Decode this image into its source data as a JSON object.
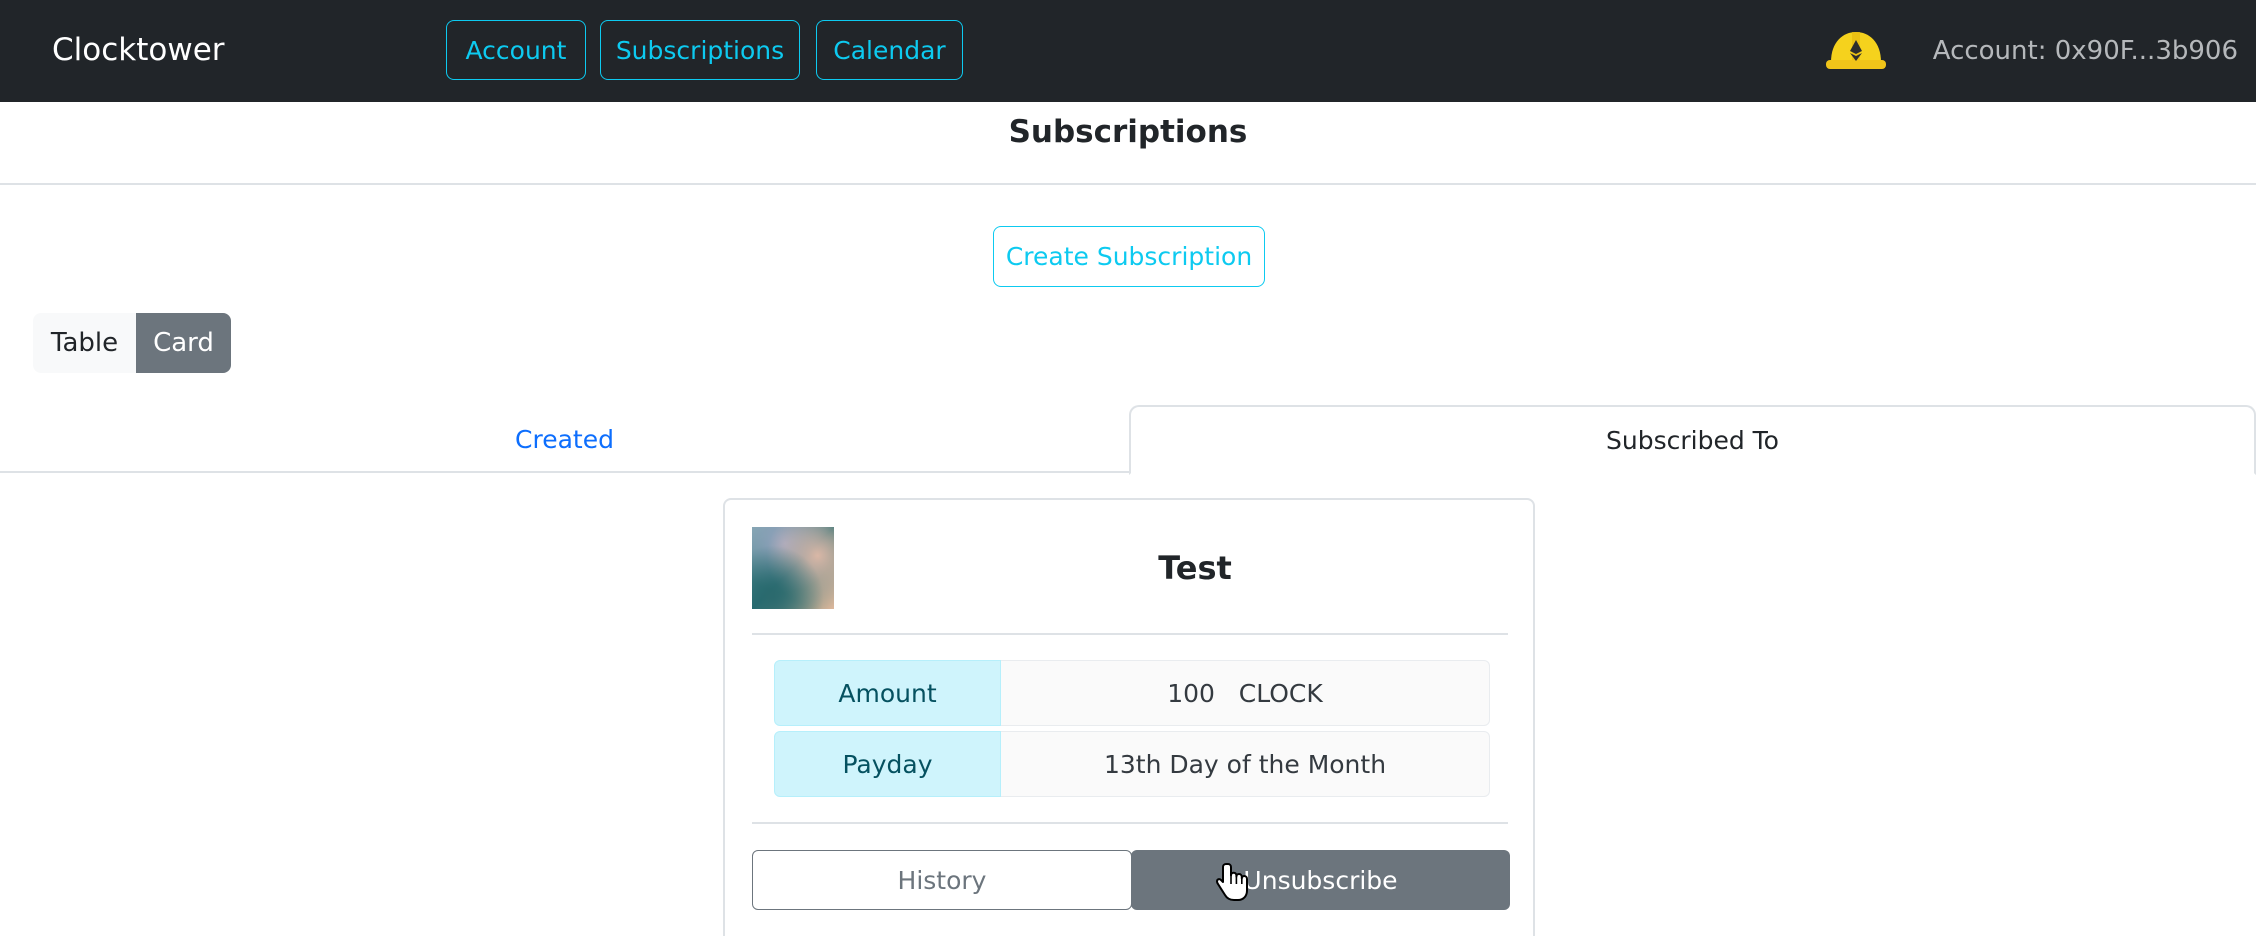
{
  "navbar": {
    "brand": "Clocktower",
    "links": [
      {
        "label": "Account"
      },
      {
        "label": "Subscriptions"
      },
      {
        "label": "Calendar"
      }
    ],
    "wallet_icon": "metamask-helmet-icon",
    "account_text": "Account: 0x90F...3b906"
  },
  "page": {
    "title": "Subscriptions",
    "create_button": "Create Subscription"
  },
  "view_toggle": {
    "options": [
      "Table",
      "Card"
    ],
    "selected": "Card"
  },
  "tabs": [
    {
      "label": "Created",
      "active": false
    },
    {
      "label": "Subscribed To",
      "active": true
    }
  ],
  "card": {
    "title": "Test",
    "rows": [
      {
        "label": "Amount",
        "value": "100   CLOCK"
      },
      {
        "label": "Payday",
        "value": "13th Day of the Month"
      }
    ],
    "history_button": "History",
    "unsubscribe_button": "Unsubscribe"
  },
  "colors": {
    "navbar_bg": "#212529",
    "accent": "#0dcaf0",
    "tab_active_link": "#0d6efd",
    "secondary": "#6c757d",
    "info_label_bg": "#cff4fc"
  }
}
